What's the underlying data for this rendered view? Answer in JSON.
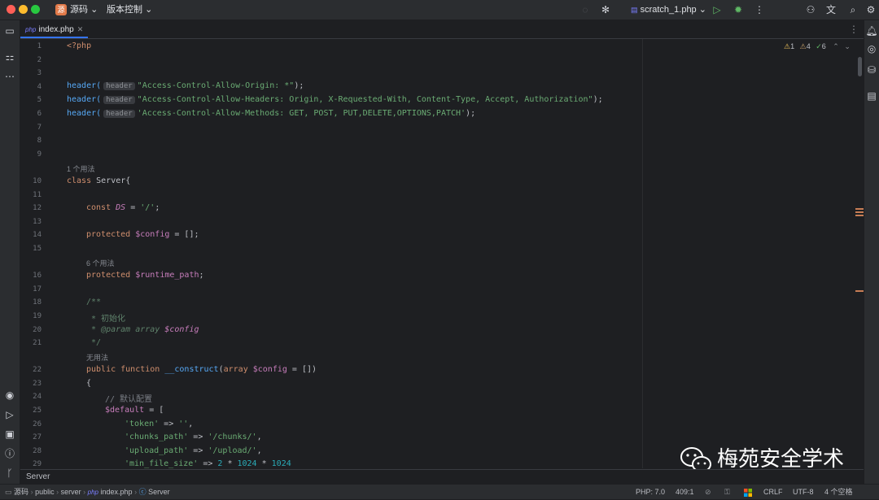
{
  "toolbar": {
    "project_badge": "源",
    "project_name": "源码",
    "vcs_label": "版本控制",
    "run_config": "scratch_1.php"
  },
  "tabs": [
    {
      "badge": "php",
      "label": "index.php"
    }
  ],
  "inspections": {
    "warnings": "1",
    "weak_warnings": "4",
    "ok": "6"
  },
  "editor": {
    "line_numbers": [
      "1",
      "2",
      "3",
      "4",
      "5",
      "6",
      "7",
      "8",
      "9",
      "10",
      "11",
      "12",
      "13",
      "14",
      "15",
      "16",
      "17",
      "18",
      "19",
      "20",
      "21",
      "22",
      "23",
      "24",
      "25",
      "26",
      "27",
      "28",
      "29"
    ],
    "usage_hints": {
      "server": "1 个用法",
      "runtime_path": "6 个用法",
      "construct": "无用法"
    },
    "inlay_hint": "header",
    "lines": {
      "l1": "<?php",
      "l4_fn": "header(",
      "l4_str": "\"Access-Control-Allow-Origin: *\"",
      "l4_end": ");",
      "l5_fn": "header(",
      "l5_str": "\"Access-Control-Allow-Headers: Origin, X-Requested-With, Content-Type, Accept, Authorization\"",
      "l5_end": ");",
      "l6_fn": "header(",
      "l6_str": "'Access-Control-Allow-Methods: GET, POST, PUT,DELETE,OPTIONS,PATCH'",
      "l6_end": ");",
      "l10_kw": "class",
      "l10_rest": " Server{",
      "l12_kw": "const",
      "l12_const": "DS",
      "l12_eq": " = ",
      "l12_str": "'/'",
      "l12_end": ";",
      "l14_kw": "protected",
      "l14_var": "$config",
      "l14_rest": " = [];",
      "l16_kw": "protected",
      "l16_var": "$runtime_path",
      "l16_end": ";",
      "l18": "/**",
      "l19": " * 初始化",
      "l20_star": " * ",
      "l20_tag": "@param",
      "l20_type": " array ",
      "l20_var": "$config",
      "l21": " */",
      "l22_kw": "public function",
      "l22_fn": "__construct",
      "l22_p1": "(",
      "l22_kw2": "array",
      "l22_var": "$config",
      "l22_rest": " = [])",
      "l23": "{",
      "l24": "// 默认配置",
      "l25_var": "$default",
      "l25_rest": " = [",
      "l26_str": "'token'",
      "l26_op": " => ",
      "l26_val": "''",
      "l26_end": ",",
      "l27_str": "'chunks_path'",
      "l27_op": " => ",
      "l27_val": "'/chunks/'",
      "l27_end": ",",
      "l28_str": "'upload_path'",
      "l28_op": " => ",
      "l28_val": "'/upload/'",
      "l28_end": ",",
      "l29_str": "'min_file_size'",
      "l29_op": " => ",
      "l29_n1": "2",
      "l29_m1": " * ",
      "l29_n2": "1024",
      "l29_m2": " * ",
      "l29_n3": "1024"
    }
  },
  "structure_bar": "Server",
  "breadcrumb": [
    "源码",
    "public",
    "server",
    "index.php",
    "Server"
  ],
  "status": {
    "php_version": "PHP: 7.0",
    "position": "409:1",
    "line_ending": "CRLF",
    "encoding": "UTF-8",
    "indent": "4 个空格"
  },
  "watermark_text": "梅苑安全学术",
  "colors": {
    "accent": "#3574f0",
    "keyword": "#cf8e6d",
    "string": "#6aab73",
    "function": "#56a8f5",
    "variable": "#c77dbb",
    "number": "#2aacb8"
  }
}
